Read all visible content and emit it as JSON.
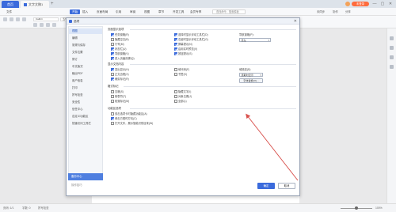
{
  "tabs": {
    "home": "首页",
    "doc": "文字文稿1"
  },
  "window": {
    "login_label": "未登录",
    "min": "—",
    "max": "▢",
    "close": "✕"
  },
  "menubar": {
    "items": [
      "文件",
      "开始",
      "插入",
      "页面布局",
      "引用",
      "审阅",
      "视图",
      "章节",
      "开发工具",
      "会员专享"
    ],
    "active_index": 1,
    "search_placeholder": "查找命令、搜索模板",
    "right_items": [
      "未同步",
      "协作",
      "分享"
    ]
  },
  "toolbar": {
    "font_name": "Calibri",
    "font_size": "五号"
  },
  "dialog": {
    "title": "选项",
    "close_icon": "✕",
    "nav_items": [
      "视图",
      "编辑",
      "常规与保存",
      "文件位置",
      "修订",
      "中文版式",
      "输出PDF",
      "用户信息",
      "打印",
      "拼写检查",
      "安全性",
      "信任中心",
      "自定义功能区",
      "快速访问工具栏"
    ],
    "nav_active_index": 0,
    "backup_label": "备份中心",
    "tips_label": "操作技巧",
    "sections": {
      "page_display": {
        "title": "页面显示选项",
        "col1": [
          {
            "label": "任务窗格(R)",
            "checked": true
          },
          {
            "label": "隐藏空白(B)",
            "checked": false
          },
          {
            "label": "行号(M)",
            "checked": false
          },
          {
            "label": "状态栏(U)",
            "checked": true
          },
          {
            "label": "导航窗格(V)",
            "checked": true
          },
          {
            "label": "进入页眉页脚(Q)",
            "checked": true
          }
        ],
        "col2": [
          {
            "label": "选择时显示浮动工具栏(D)",
            "checked": true
          },
          {
            "label": "右键时显示浮动工具栏(G)",
            "checked": true
          },
          {
            "label": "屏幕提示(N)",
            "checked": true
          },
          {
            "label": "启用实时预览(V)",
            "checked": true
          },
          {
            "label": "按钮提示(S)",
            "checked": true
          }
        ],
        "nav_pane_label": "导航窗格(P):",
        "nav_pane_value": "靠左"
      },
      "show_formatting": {
        "title": "显示文档内容",
        "col1": [
          {
            "label": "突出显示(H)",
            "checked": true
          },
          {
            "label": "正文边框(X)",
            "checked": false
          },
          {
            "label": "裁剪标记(R)",
            "checked": true
          }
        ],
        "col2": [
          {
            "label": "域代码(F)",
            "checked": false
          },
          {
            "label": "书签(K)",
            "checked": false
          }
        ],
        "field_shading_label": "域底纹(E):",
        "field_shading_value": "选取时显示",
        "font_replace_label": "字体替换(O)..."
      },
      "format_marks": {
        "title": "格式标记",
        "col1": [
          {
            "label": "空格(S)",
            "checked": false
          },
          {
            "label": "制表符(T)",
            "checked": false
          },
          {
            "label": "段落标记(M)",
            "checked": false
          }
        ],
        "col2": [
          {
            "label": "隐藏文字(I)",
            "checked": false
          },
          {
            "label": "对象位置(J)",
            "checked": false
          },
          {
            "label": "全部(L)",
            "checked": false
          }
        ]
      },
      "function_area": {
        "title": "功能区选项",
        "items": [
          {
            "label": "双击选项卡时隐藏功能区(A)",
            "checked": false
          },
          {
            "label": "单击方框时打勾(C)",
            "checked": true
          },
          {
            "label": "打开文件，展示智能识别目录(W)",
            "checked": false
          }
        ]
      }
    },
    "ok_label": "确定",
    "cancel_label": "取消"
  },
  "statusbar": {
    "page_info": "页码: 1/1",
    "words": "字数: 0",
    "spell": "拼写检查",
    "zoom": "100%"
  },
  "colors": {
    "accent": "#3b6bdc",
    "annotation_arrow": "#d9534f"
  }
}
